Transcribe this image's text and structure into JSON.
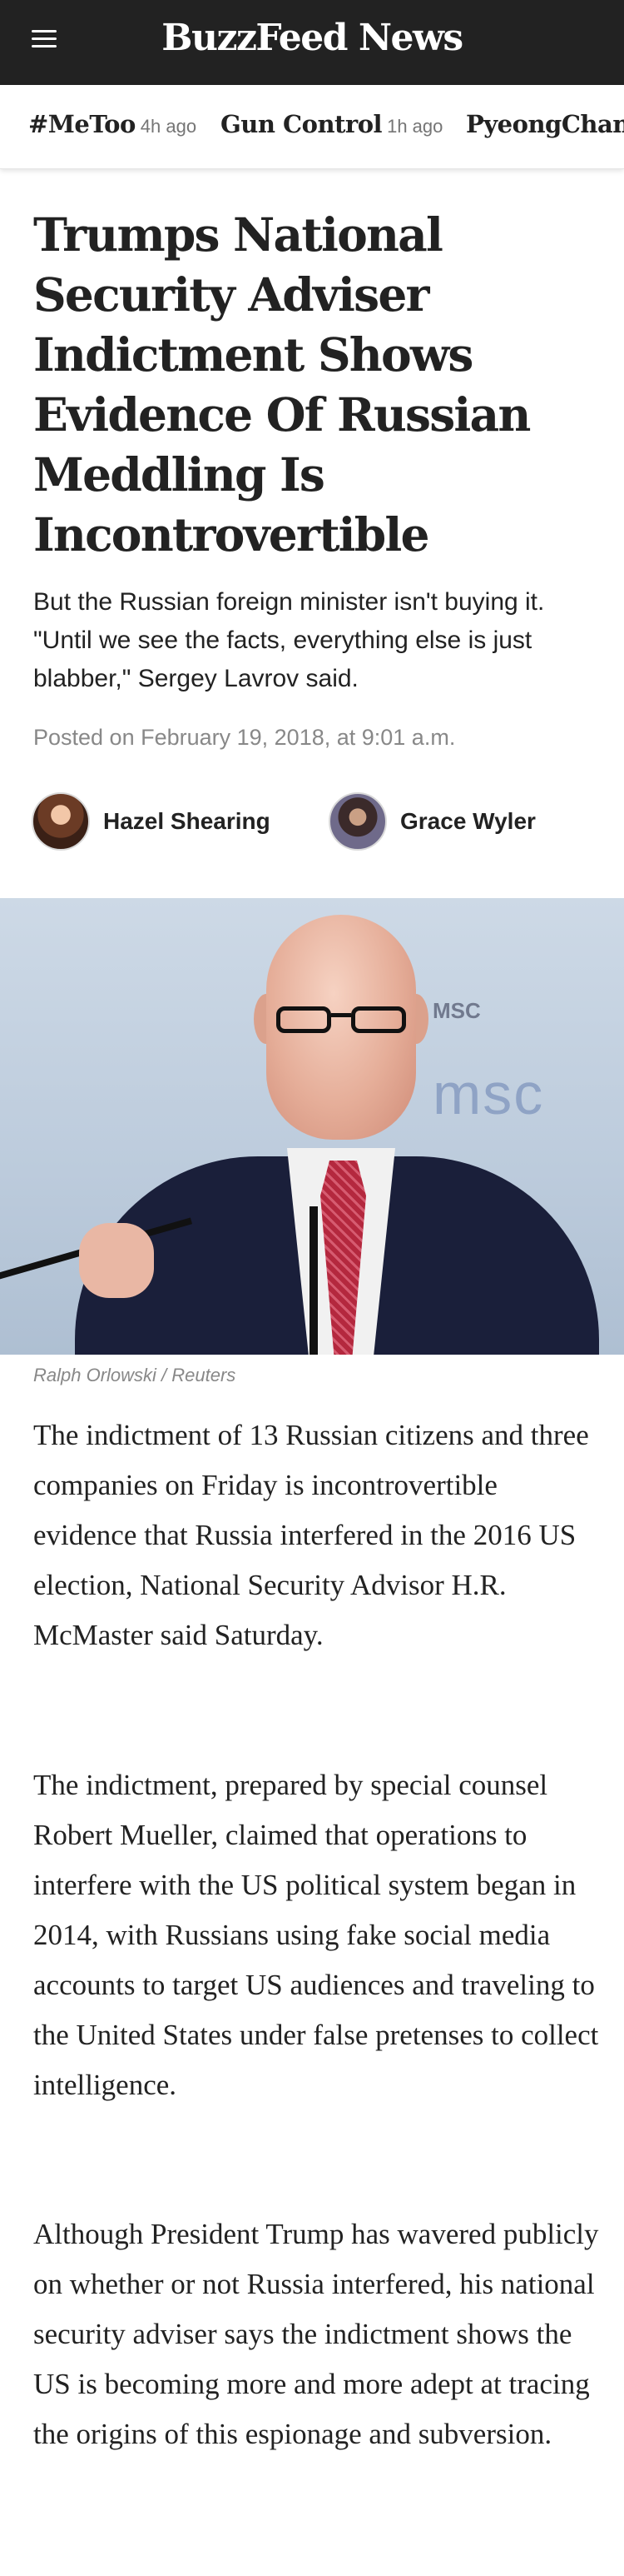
{
  "header": {
    "brand": "BuzzFeed News",
    "menu_icon": "hamburger-menu-icon"
  },
  "trending": [
    {
      "topic": "#MeToo",
      "age": "4h ago"
    },
    {
      "topic": "Gun Control",
      "age": "1h ago"
    },
    {
      "topic": "PyeongChang",
      "age": ""
    }
  ],
  "article": {
    "headline": "Trumps National Security Adviser Indictment Shows Evidence Of Russian Meddling Is Incontrovertible",
    "dek": "But the Russian foreign minister isn't buying it. \"Until we see the facts, everything else is just blabber,\" Sergey Lavrov said.",
    "posted": "Posted on February 19, 2018, at 9:01 a.m.",
    "authors": [
      {
        "name": "Hazel Shearing"
      },
      {
        "name": "Grace Wyler"
      }
    ],
    "photo_caption": "Ralph Orlowski / Reuters",
    "paragraphs": [
      "The indictment of 13 Russian citizens and three companies on Friday is incontrovertible evidence that Russia interfered in the 2016 US election, National Security Advisor H.R. McMaster said Saturday.",
      "The indictment, prepared by special counsel Robert Mueller, claimed that operations to interfere with the US political system began in 2014, with Russians using fake social media accounts to target US audiences and traveling to the United States under false pretenses to collect intelligence.",
      "Although President Trump has wavered publicly on whether or not Russia interfered, his national security adviser says the indictment shows the US is becoming more and more adept at tracing the origins of this espionage and subversion."
    ]
  },
  "colors": {
    "header_bg": "#222222",
    "text": "#222222",
    "muted": "#888888"
  }
}
